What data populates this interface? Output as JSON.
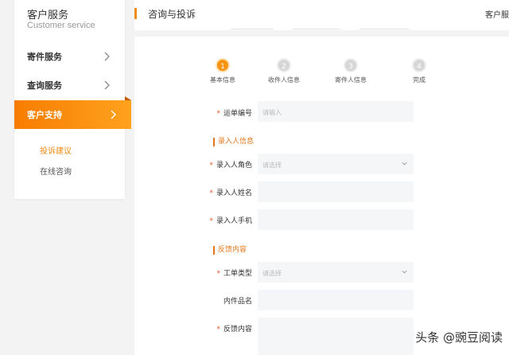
{
  "sidebar": {
    "title": "客户服务",
    "subtitle": "Customer service",
    "items": [
      {
        "label": "寄件服务"
      },
      {
        "label": "查询服务"
      },
      {
        "label": "客户支持"
      }
    ],
    "sub_items": [
      {
        "label": "投诉建议"
      },
      {
        "label": "在线咨询"
      }
    ]
  },
  "header": {
    "title": "咨询与投诉",
    "right_text": "客户服"
  },
  "steps": [
    {
      "num": "1",
      "label": "基本信息"
    },
    {
      "num": "2",
      "label": "收件人信息"
    },
    {
      "num": "3",
      "label": "寄件人信息"
    },
    {
      "num": "4",
      "label": "完成"
    }
  ],
  "form": {
    "tracking_label": "运单编号",
    "tracking_placeholder": "请输入",
    "section_entry": "录入人信息",
    "role_label": "录入人角色",
    "role_placeholder": "请选择",
    "name_label": "录入人姓名",
    "phone_label": "录入人手机",
    "section_feedback": "反馈内容",
    "type_label": "工单类型",
    "type_placeholder": "请选择",
    "item_label": "内件品名",
    "content_label": "反馈内容"
  },
  "watermark": "头条 @豌豆阅读",
  "colors": {
    "accent": "#f08a12",
    "required": "#f0552b"
  }
}
